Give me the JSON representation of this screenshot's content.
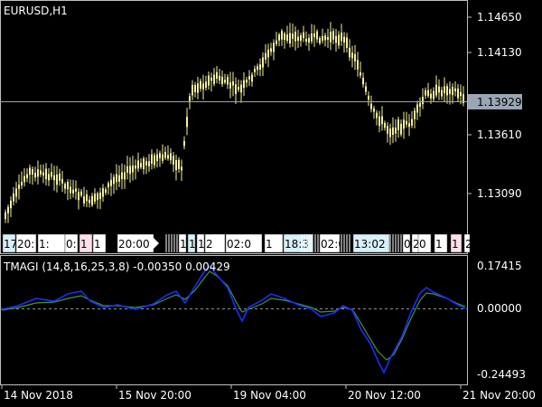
{
  "main_panel": {
    "symbol_label": "EURUSD,H1",
    "price_ticks": [
      "1.14650",
      "1.14130",
      "1.13610",
      "1.13090"
    ],
    "current_price": "1.13929",
    "event_labels": [
      "17:",
      "20:",
      "1:",
      "0:",
      "1",
      "1",
      "20:00",
      "1",
      "1",
      "1",
      "2",
      "02:0",
      "1",
      "18:3",
      "02:0",
      "13:02",
      "0",
      "2",
      "0",
      "1",
      "1",
      "2"
    ]
  },
  "indicator_panel": {
    "label": "TMAGI (14,8,16,25,3,8) -0.00350 0.00429",
    "ticks": [
      "0.17415",
      "0.00000",
      "-0.24493"
    ]
  },
  "time_axis": {
    "labels": [
      "14 Nov 2018",
      "15 Nov 20:00",
      "19 Nov 04:00",
      "20 Nov 12:00",
      "21 Nov 20:00"
    ]
  },
  "colors": {
    "background": "#000000",
    "candle": "#f5f0a0",
    "axis": "#c0c0c0",
    "price_line": "#9aa6b4",
    "price_badge": "#9aa6b4",
    "line_blue": "#1c2cff",
    "line_green": "#3a9a3a",
    "zero_line": "#909090"
  }
}
